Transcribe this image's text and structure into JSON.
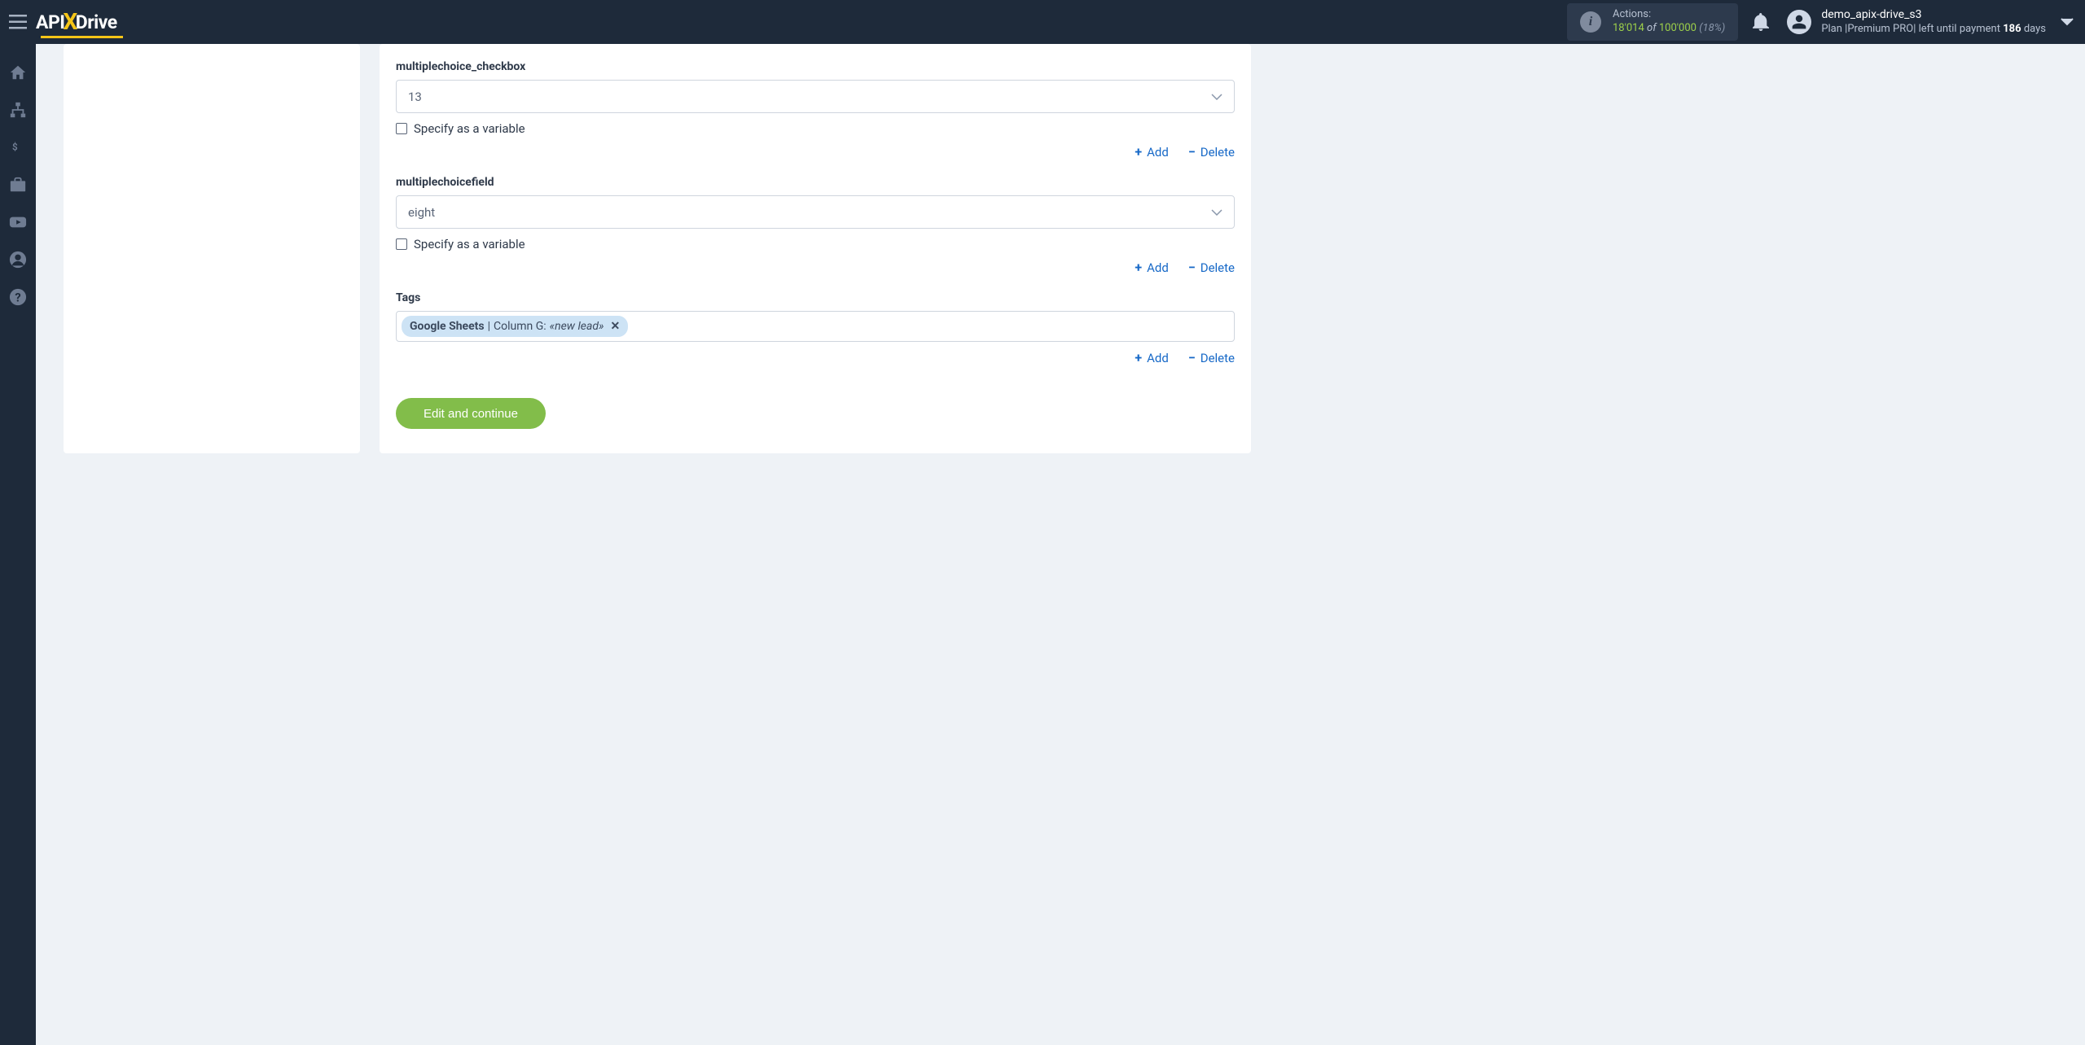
{
  "header": {
    "logo_pre": "API",
    "logo_x": "X",
    "logo_post": "Drive",
    "actions_label": "Actions:",
    "actions_used": "18'014",
    "actions_of": "of",
    "actions_total": "100'000",
    "actions_pct": "(18%)",
    "username": "demo_apix-drive_s3",
    "plan_prefix": "Plan |",
    "plan_name": "Premium PRO",
    "plan_mid": "| left until payment",
    "plan_days_num": "186",
    "plan_days_unit": "days"
  },
  "form": {
    "field1": {
      "label": "multiplechoice_checkbox",
      "value": "13",
      "checkbox_label": "Specify as a variable",
      "add": "Add",
      "delete": "Delete"
    },
    "field2": {
      "label": "multiplechoicefield",
      "value": "eight",
      "checkbox_label": "Specify as a variable",
      "add": "Add",
      "delete": "Delete"
    },
    "field3": {
      "label": "Tags",
      "tag_source": "Google Sheets",
      "tag_sep": " | ",
      "tag_col": "Column G: ",
      "tag_val": "«new lead»",
      "add": "Add",
      "delete": "Delete"
    },
    "submit": "Edit and continue"
  }
}
